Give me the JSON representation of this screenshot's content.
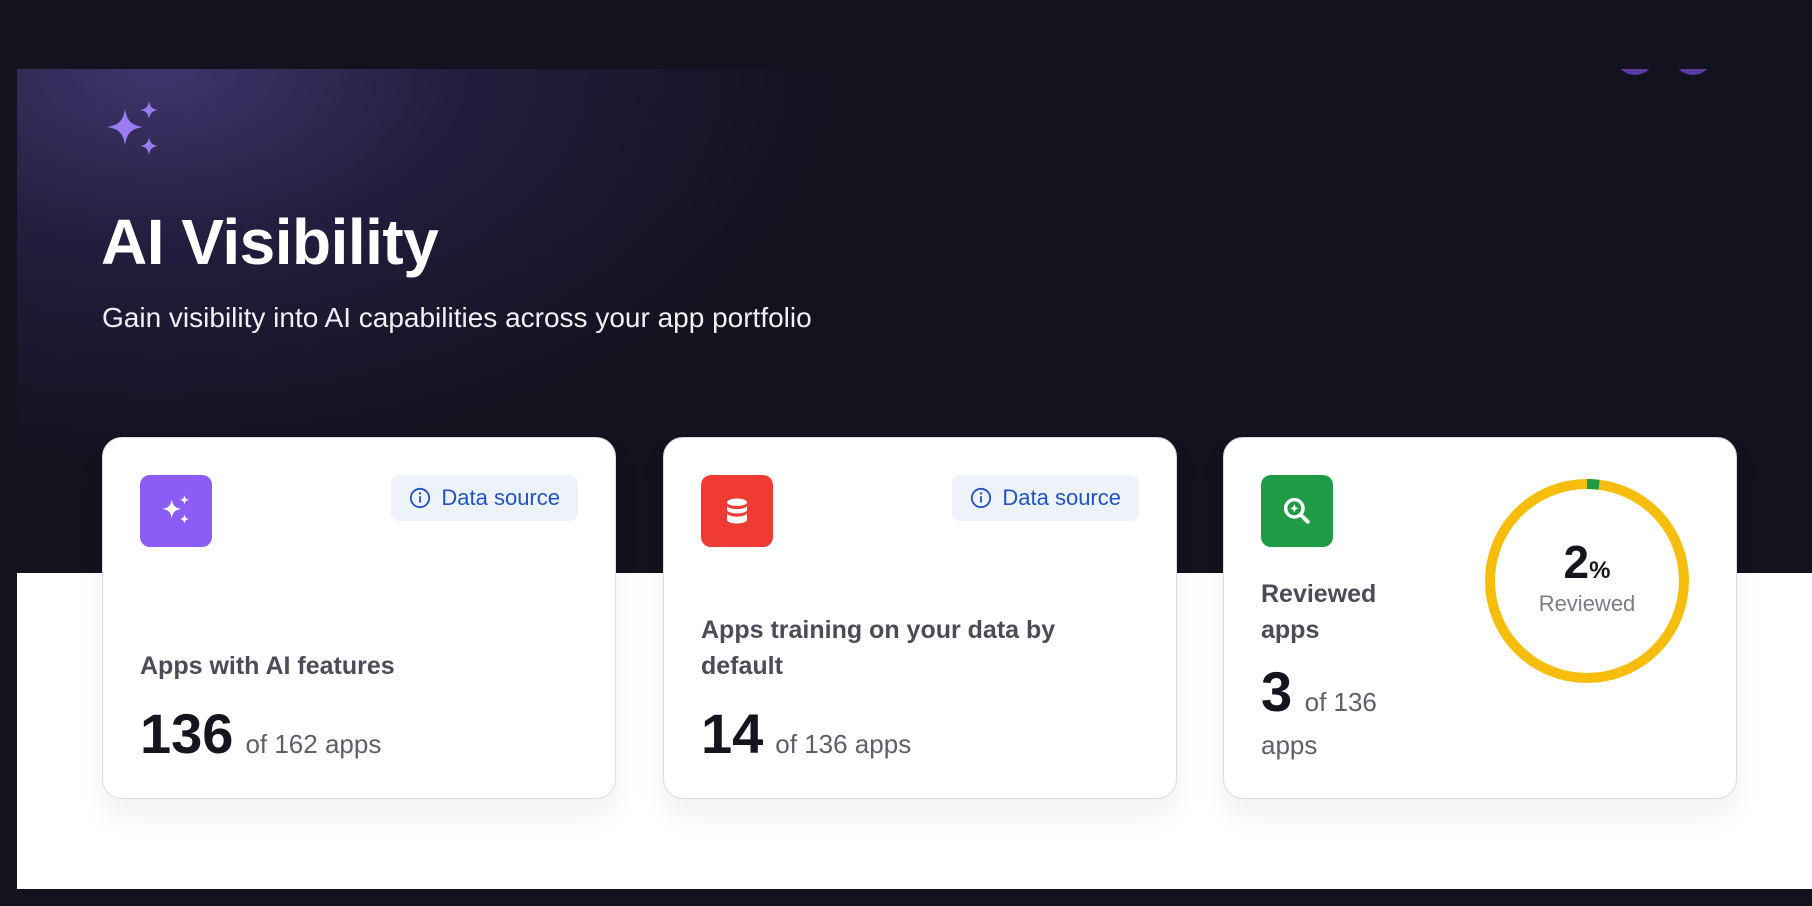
{
  "page": {
    "title": "AI Visibility",
    "subtitle": "Gain visibility into AI capabilities across your app portfolio"
  },
  "icons": {
    "hero": "sparkles-icon",
    "card1": "sparkles-icon",
    "card2": "database-icon",
    "card3": "search-plus-icon",
    "data_source": "info-icon"
  },
  "colors": {
    "background": "#13121f",
    "ai_purple": "#8b5cf6",
    "database_red": "#ef3b33",
    "review_green": "#1f9a45",
    "ring_yellow": "#f7bd0b",
    "link_blue": "#1f54c8"
  },
  "cards": [
    {
      "data_source_label": "Data source",
      "label": "Apps with AI features",
      "value": "136",
      "of_text": "of 162 apps"
    },
    {
      "data_source_label": "Data source",
      "label": "Apps training on your data by default",
      "value": "14",
      "of_text": "of 136 apps"
    },
    {
      "label": "Reviewed apps",
      "value": "3",
      "of_text": "of 136 apps",
      "percent": "2",
      "percent_symbol": "%",
      "percent_label": "Reviewed",
      "reviewed_fraction": 0.02
    }
  ]
}
